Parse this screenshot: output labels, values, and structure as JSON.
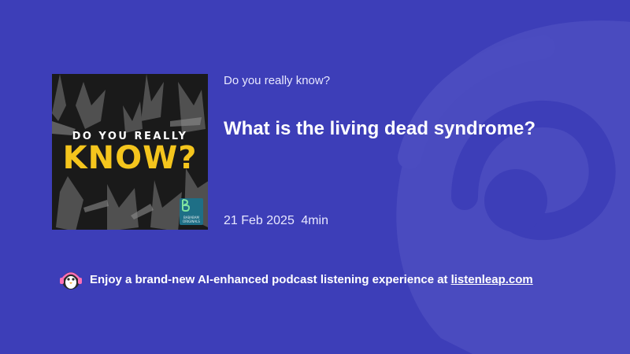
{
  "episode": {
    "show_name": "Do you really know?",
    "title": "What is the living dead syndrome?",
    "date": "21 Feb 2025",
    "duration": "4min"
  },
  "cover": {
    "line1": "DO YOU REALLY",
    "line2": "KNOW?",
    "badge_text": "BABABAM ORIGINALS",
    "accent": "#f4c51d",
    "badge_color": "#1e6f86"
  },
  "footer": {
    "text": "Enjoy a brand-new AI-enhanced podcast listening experience at",
    "link_text": "listenleap.com",
    "mascot_icon": "penguin-headphones-icon"
  },
  "colors": {
    "background": "#3d3eb8"
  }
}
